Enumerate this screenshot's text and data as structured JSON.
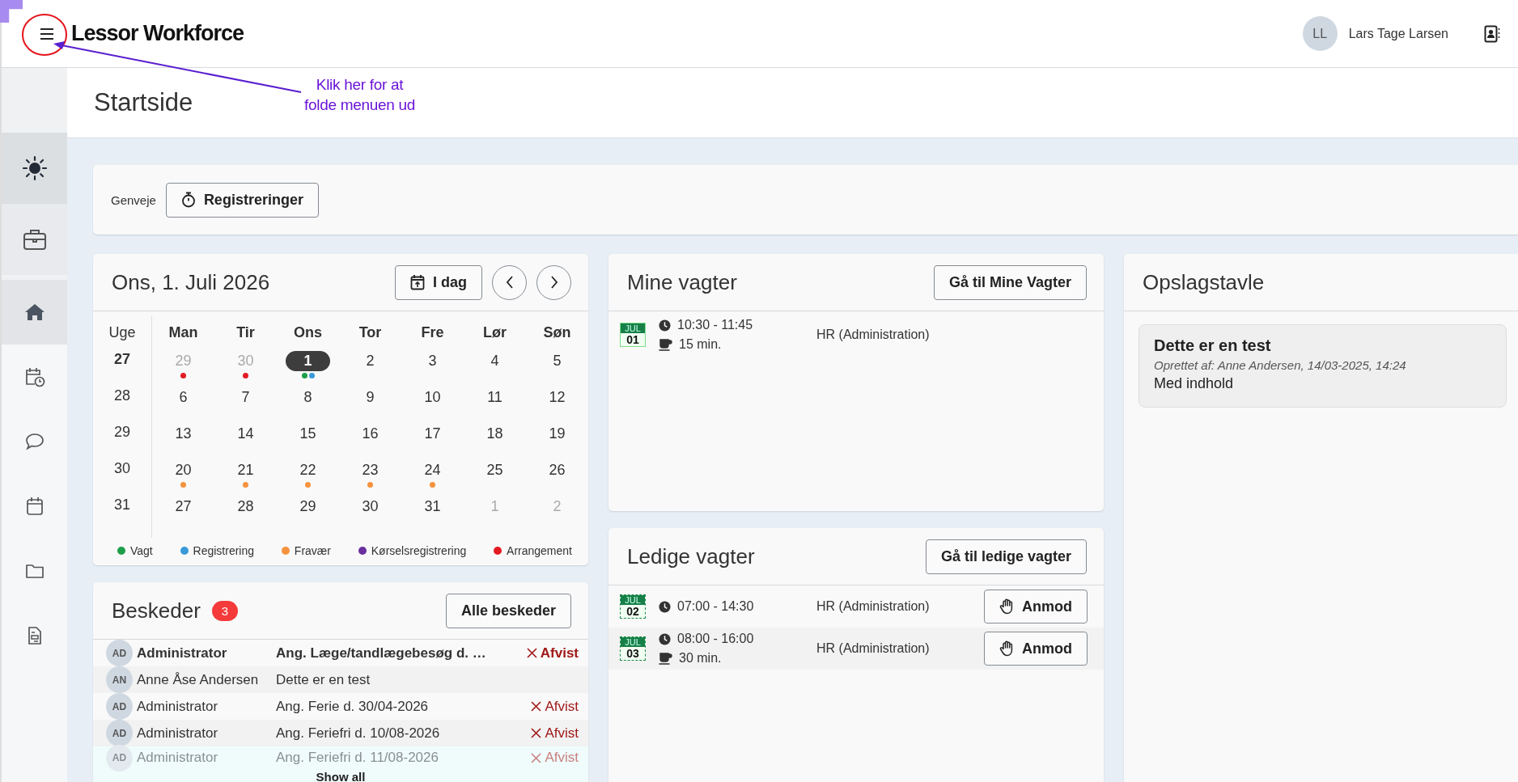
{
  "header": {
    "logo": "Lessor Workforce",
    "user": {
      "initials": "LL",
      "name": "Lars Tage Larsen"
    }
  },
  "annotation": {
    "lines": [
      "Klik her for at",
      "folde menuen ud"
    ]
  },
  "sidebar": {
    "top_items": [
      {
        "kind": "sun",
        "selected": true
      },
      {
        "kind": "briefcase",
        "selected": false
      }
    ],
    "items": [
      {
        "kind": "home",
        "selected": true
      },
      {
        "kind": "schedule",
        "selected": false
      },
      {
        "kind": "chat",
        "selected": false
      },
      {
        "kind": "calendar",
        "selected": false
      },
      {
        "kind": "folder",
        "selected": false
      },
      {
        "kind": "document",
        "selected": false
      }
    ]
  },
  "page": {
    "title": "Startside"
  },
  "shortcuts": {
    "label": "Genveje",
    "buttons": [
      {
        "label": "Registreringer"
      }
    ]
  },
  "calendar": {
    "title": "Ons, 1. Juli 2026",
    "today_button": "I dag",
    "week_label": "Uge",
    "weekdays": [
      "Man",
      "Tir",
      "Ons",
      "Tor",
      "Fre",
      "Lør",
      "Søn"
    ],
    "weeks": [
      {
        "number": "27",
        "current": true,
        "days": [
          {
            "day": "29",
            "muted": true,
            "selected": false,
            "dots": [
              {
                "color": "#e31b23"
              }
            ]
          },
          {
            "day": "30",
            "muted": true,
            "selected": false,
            "dots": [
              {
                "color": "#e31b23"
              }
            ]
          },
          {
            "day": "1",
            "muted": false,
            "selected": true,
            "dots": [
              {
                "color": "#1e9e4a"
              },
              {
                "color": "#3a9ad9"
              }
            ]
          },
          {
            "day": "2",
            "muted": false,
            "selected": false
          },
          {
            "day": "3",
            "muted": false,
            "selected": false
          },
          {
            "day": "4",
            "muted": false,
            "selected": false
          },
          {
            "day": "5",
            "muted": false,
            "selected": false
          }
        ]
      },
      {
        "number": "28",
        "current": false,
        "days": [
          {
            "day": "6",
            "muted": false,
            "selected": false
          },
          {
            "day": "7",
            "muted": false,
            "selected": false
          },
          {
            "day": "8",
            "muted": false,
            "selected": false
          },
          {
            "day": "9",
            "muted": false,
            "selected": false
          },
          {
            "day": "10",
            "muted": false,
            "selected": false
          },
          {
            "day": "11",
            "muted": false,
            "selected": false
          },
          {
            "day": "12",
            "muted": false,
            "selected": false
          }
        ]
      },
      {
        "number": "29",
        "current": false,
        "days": [
          {
            "day": "13",
            "muted": false,
            "selected": false
          },
          {
            "day": "14",
            "muted": false,
            "selected": false
          },
          {
            "day": "15",
            "muted": false,
            "selected": false
          },
          {
            "day": "16",
            "muted": false,
            "selected": false
          },
          {
            "day": "17",
            "muted": false,
            "selected": false
          },
          {
            "day": "18",
            "muted": false,
            "selected": false
          },
          {
            "day": "19",
            "muted": false,
            "selected": false
          }
        ]
      },
      {
        "number": "30",
        "current": false,
        "days": [
          {
            "day": "20",
            "muted": false,
            "selected": false,
            "dots": [
              {
                "color": "#f5923e"
              }
            ]
          },
          {
            "day": "21",
            "muted": false,
            "selected": false,
            "dots": [
              {
                "color": "#f5923e"
              }
            ]
          },
          {
            "day": "22",
            "muted": false,
            "selected": false,
            "dots": [
              {
                "color": "#f5923e"
              }
            ]
          },
          {
            "day": "23",
            "muted": false,
            "selected": false,
            "dots": [
              {
                "color": "#f5923e"
              }
            ]
          },
          {
            "day": "24",
            "muted": false,
            "selected": false,
            "dots": [
              {
                "color": "#f5923e"
              }
            ]
          },
          {
            "day": "25",
            "muted": false,
            "selected": false
          },
          {
            "day": "26",
            "muted": false,
            "selected": false
          }
        ]
      },
      {
        "number": "31",
        "current": false,
        "days": [
          {
            "day": "27",
            "muted": false,
            "selected": false
          },
          {
            "day": "28",
            "muted": false,
            "selected": false
          },
          {
            "day": "29",
            "muted": false,
            "selected": false
          },
          {
            "day": "30",
            "muted": false,
            "selected": false
          },
          {
            "day": "31",
            "muted": false,
            "selected": false
          },
          {
            "day": "1",
            "muted": true,
            "selected": false
          },
          {
            "day": "2",
            "muted": true,
            "selected": false
          }
        ]
      }
    ],
    "legend": [
      {
        "label": "Vagt",
        "color": "#1e9e4a"
      },
      {
        "label": "Registrering",
        "color": "#3a9ad9"
      },
      {
        "label": "Fravær",
        "color": "#f5923e"
      },
      {
        "label": "Kørselsregistrering",
        "color": "#6b2fa0"
      },
      {
        "label": "Arrangement",
        "color": "#e31b23"
      }
    ]
  },
  "messages": {
    "title": "Beskeder",
    "count": "3",
    "button": "Alle beskeder",
    "show_all": "Show all",
    "rows": [
      {
        "initials": "AD",
        "sender": "Administrator",
        "subject": "Ang. Læge/tandlægebesøg d. …",
        "status": "Afvist",
        "unread": true,
        "faded": false
      },
      {
        "initials": "AN",
        "sender": "Anne Åse Andersen",
        "subject": "Dette er en test",
        "unread": false,
        "faded": false
      },
      {
        "initials": "AD",
        "sender": "Administrator",
        "subject": "Ang. Ferie d. 30/04-2026",
        "status": "Afvist",
        "unread": false,
        "faded": false
      },
      {
        "initials": "AD",
        "sender": "Administrator",
        "subject": "Ang. Feriefri d. 10/08-2026",
        "status": "Afvist",
        "unread": false,
        "faded": false
      },
      {
        "initials": "AD",
        "sender": "Administrator",
        "subject": "Ang. Feriefri d. 11/08-2026",
        "status": "Afvist",
        "unread": false,
        "faded": true
      }
    ]
  },
  "my_shifts": {
    "title": "Mine vagter",
    "button": "Gå til Mine Vagter",
    "rows": [
      {
        "month": "JUL",
        "day": "01",
        "time": "10:30 - 11:45",
        "break": "15 min.",
        "department": "HR (Administration)"
      }
    ]
  },
  "open_shifts": {
    "title": "Ledige vagter",
    "button": "Gå til ledige vagter",
    "rows": [
      {
        "month": "JUL",
        "day": "02",
        "time": "07:00 - 14:30",
        "department": "HR (Administration)",
        "action": "Anmod"
      },
      {
        "month": "JUL",
        "day": "03",
        "time": "08:00 - 16:00",
        "break": "30 min.",
        "department": "HR (Administration)",
        "action": "Anmod"
      }
    ]
  },
  "board": {
    "title": "Opslagstavle",
    "posts": [
      {
        "title": "Dette er en test",
        "meta": "Oprettet af: Anne Andersen, 14/03-2025, 14:24",
        "body": "Med indhold"
      }
    ]
  }
}
